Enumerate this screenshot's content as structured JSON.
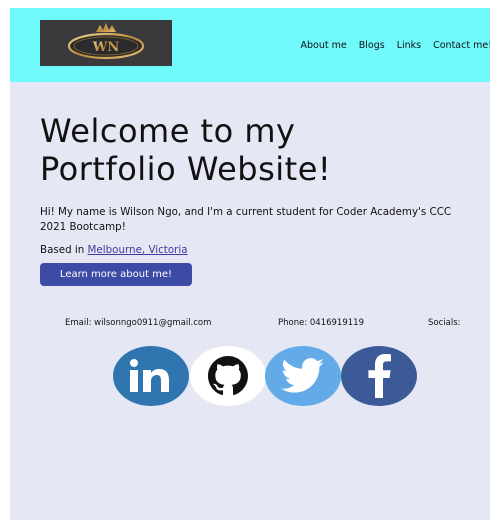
{
  "header": {
    "logo_text": "WN",
    "nav": [
      {
        "label": "About me"
      },
      {
        "label": "Blogs"
      },
      {
        "label": "Links"
      },
      {
        "label": "Contact me!"
      }
    ]
  },
  "hero": {
    "title_line1": "Welcome to my",
    "title_line2": "Portfolio Website!",
    "intro": "Hi! My name is Wilson Ngo, and I'm a current student for Coder Academy's CCC 2021 Bootcamp!",
    "based_prefix": "Based in ",
    "based_link": "Melbourne, Victoria",
    "button_label": "Learn more about me!"
  },
  "contact": {
    "email": "Email: wilsonngo0911@gmail.com",
    "phone": "Phone: 0416919119",
    "socials_label": "Socials:"
  },
  "socials": [
    {
      "name": "linkedin-icon"
    },
    {
      "name": "github-icon"
    },
    {
      "name": "twitter-icon"
    },
    {
      "name": "facebook-icon"
    }
  ],
  "colors": {
    "header_bg": "#70fafc",
    "page_bg": "#e6e7f4",
    "button_bg": "#3d4aa6",
    "link": "#4636a0",
    "linkedin": "#2f76b1",
    "twitter": "#63abe8",
    "facebook": "#3b5a97"
  }
}
